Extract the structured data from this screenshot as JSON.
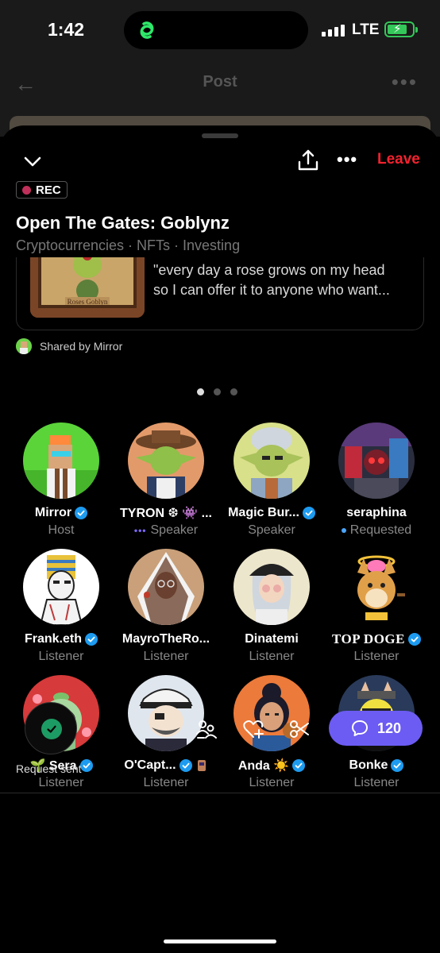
{
  "status_bar": {
    "time": "1:42",
    "network": "LTE"
  },
  "post_header": {
    "title": "Post"
  },
  "space": {
    "leave_label": "Leave",
    "rec_label": "REC",
    "title": "Open The Gates: Goblynz",
    "topics": "Cryptocurrencies · NFTs · Investing",
    "shared_card": {
      "line1": "\"every day a rose grows on my head",
      "line2": "so I can offer it to anyone who want...",
      "thumb_caption": "Roses Goblyn"
    },
    "shared_by": "Shared by Mirror",
    "page_count": 3,
    "active_page": 1
  },
  "participants": [
    {
      "name": "Mirror",
      "role": "Host",
      "verified": true,
      "status": "none"
    },
    {
      "name": "TYRON ❆ 👾 ...",
      "role": "Speaker",
      "verified": false,
      "status": "speaking"
    },
    {
      "name": "Magic Bur...",
      "role": "Speaker",
      "verified": true,
      "status": "none"
    },
    {
      "name": "seraphina",
      "role": "Requested",
      "verified": false,
      "status": "requested"
    },
    {
      "name": "Frank.eth",
      "role": "Listener",
      "verified": true,
      "status": "none"
    },
    {
      "name": "MayroTheRo...",
      "role": "Listener",
      "verified": false,
      "status": "none"
    },
    {
      "name": "Dinatemi",
      "role": "Listener",
      "verified": false,
      "status": "none"
    },
    {
      "name": "TOP DOGE",
      "role": "Listener",
      "verified": true,
      "status": "none"
    },
    {
      "name": "🌱 Sera",
      "role": "Listener",
      "verified": true,
      "status": "none"
    },
    {
      "name": "O'Capt...",
      "role": "Listener",
      "verified": true,
      "status": "none"
    },
    {
      "name": "Anda ☀️",
      "role": "Listener",
      "verified": true,
      "status": "none"
    },
    {
      "name": "Bonke",
      "role": "Listener",
      "verified": true,
      "status": "none"
    }
  ],
  "bottom_bar": {
    "request_label": "Request sent",
    "comment_count": "120"
  },
  "colors": {
    "leave": "#f4212e",
    "accent": "#6c5cf3",
    "verified": "#1d9bf0",
    "success": "#1d9b64"
  }
}
